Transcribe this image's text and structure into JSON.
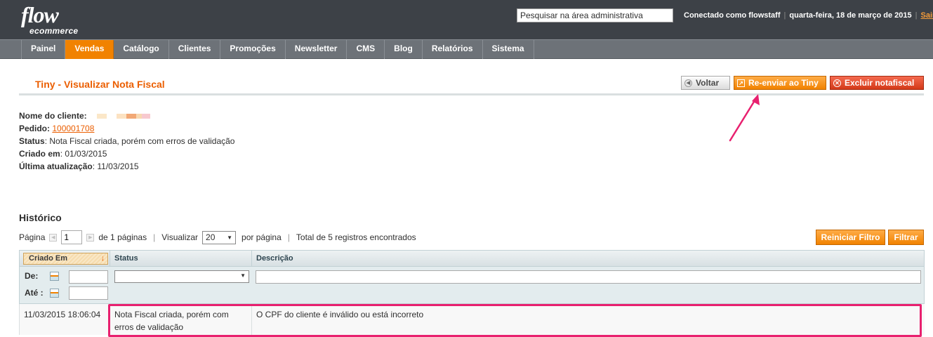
{
  "header": {
    "logo_main": "flow",
    "logo_sub": "ecommerce",
    "search_placeholder": "Pesquisar na área administrativa",
    "connected_as": "Conectado como flowstaff",
    "date": "quarta-feira, 18 de março de 2015",
    "logout": "Sair"
  },
  "nav": {
    "items": [
      "Painel",
      "Vendas",
      "Catálogo",
      "Clientes",
      "Promoções",
      "Newsletter",
      "CMS",
      "Blog",
      "Relatórios",
      "Sistema"
    ],
    "active": "Vendas"
  },
  "page": {
    "title": "Tiny - Visualizar Nota Fiscal",
    "buttons": {
      "back": "Voltar",
      "resend": "Re-enviar ao Tiny",
      "delete": "Excluir notafiscal"
    }
  },
  "info": {
    "customer_label": "Nome do cliente:",
    "order_label": "Pedido:",
    "order_value": "100001708",
    "status_label": "Status",
    "status_value": ": Nota Fiscal criada, porém com erros de validação",
    "created_label": "Criado em",
    "created_value": ": 01/03/2015",
    "updated_label": "Última atualização",
    "updated_value": ": 11/03/2015"
  },
  "history": {
    "title": "Histórico",
    "pager": {
      "page_label": "Página",
      "page_value": "1",
      "of_pages": "de 1 páginas",
      "view_label": "Visualizar",
      "per_page": "20",
      "per_page_label": "por página",
      "total": "Total de 5 registros encontrados"
    },
    "reset_filter": "Reiniciar Filtro",
    "filter": "Filtrar",
    "columns": {
      "created": "Criado Em",
      "status": "Status",
      "description": "Descrição"
    },
    "filter_labels": {
      "from": "De:",
      "to": "Até :"
    },
    "rows": [
      {
        "created": "11/03/2015 18:06:04",
        "status": "Nota Fiscal criada, porém com erros de validação",
        "description": "O CPF do cliente é inválido ou está incorreto"
      }
    ]
  },
  "colors": {
    "accent": "#f18200",
    "title": "#eb5e00",
    "highlight": "#e8206f"
  }
}
